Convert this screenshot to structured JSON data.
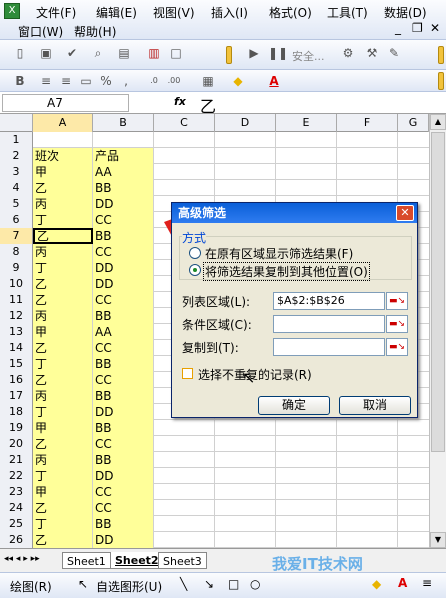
{
  "menubar": {
    "items": [
      "文件(F)",
      "编辑(E)",
      "视图(V)",
      "插入(I)",
      "格式(O)",
      "工具(T)",
      "数据(D)"
    ],
    "items2": [
      "窗口(W)",
      "帮助(H)"
    ],
    "window_controls": [
      "_",
      "❐",
      "✕"
    ]
  },
  "toolbar1": {
    "security_label": "安全..."
  },
  "formula_bar": {
    "cell_ref": "A7",
    "fx": "fx",
    "value": "乙"
  },
  "columns": [
    "A",
    "B",
    "C",
    "D",
    "E",
    "F",
    "G"
  ],
  "rows": [
    {
      "n": "1",
      "a": "",
      "b": ""
    },
    {
      "n": "2",
      "a": "班次",
      "b": "产品"
    },
    {
      "n": "3",
      "a": "甲",
      "b": "AA"
    },
    {
      "n": "4",
      "a": "乙",
      "b": "BB"
    },
    {
      "n": "5",
      "a": "丙",
      "b": "DD"
    },
    {
      "n": "6",
      "a": "丁",
      "b": "CC"
    },
    {
      "n": "7",
      "a": "乙",
      "b": "BB"
    },
    {
      "n": "8",
      "a": "丙",
      "b": "CC"
    },
    {
      "n": "9",
      "a": "丁",
      "b": "DD"
    },
    {
      "n": "10",
      "a": "乙",
      "b": "DD"
    },
    {
      "n": "11",
      "a": "乙",
      "b": "CC"
    },
    {
      "n": "12",
      "a": "丙",
      "b": "BB"
    },
    {
      "n": "13",
      "a": "甲",
      "b": "AA"
    },
    {
      "n": "14",
      "a": "乙",
      "b": "CC"
    },
    {
      "n": "15",
      "a": "丁",
      "b": "BB"
    },
    {
      "n": "16",
      "a": "乙",
      "b": "CC"
    },
    {
      "n": "17",
      "a": "丙",
      "b": "BB"
    },
    {
      "n": "18",
      "a": "丁",
      "b": "DD"
    },
    {
      "n": "19",
      "a": "甲",
      "b": "BB"
    },
    {
      "n": "20",
      "a": "乙",
      "b": "CC"
    },
    {
      "n": "21",
      "a": "丙",
      "b": "BB"
    },
    {
      "n": "22",
      "a": "丁",
      "b": "DD"
    },
    {
      "n": "23",
      "a": "甲",
      "b": "CC"
    },
    {
      "n": "24",
      "a": "乙",
      "b": "CC"
    },
    {
      "n": "25",
      "a": "丁",
      "b": "BB"
    },
    {
      "n": "26",
      "a": "乙",
      "b": "DD"
    }
  ],
  "sheets": [
    "Sheet1",
    "Sheet2",
    "Sheet3"
  ],
  "drawbar": {
    "draw_label": "绘图(R)",
    "autoshape_label": "自选图形(U)"
  },
  "dialog": {
    "title": "高级筛选",
    "close": "✕",
    "group_label": "方式",
    "option1": "在原有区域显示筛选结果(F)",
    "option2": "将筛选结果复制到其他位置(O)",
    "list_range_label": "列表区域(L):",
    "list_range_value": "$A$2:$B$26",
    "criteria_label": "条件区域(C):",
    "criteria_value": "",
    "copy_to_label": "复制到(T):",
    "copy_to_value": "",
    "unique_label": "选择不重复的记录(R)",
    "ok_label": "确定",
    "cancel_label": "取消"
  },
  "watermark": "我爱IT技术网",
  "colors": {
    "highlight": "#ffff99",
    "title_bar": "#0a5fd8",
    "arrow": "#e0201c"
  }
}
